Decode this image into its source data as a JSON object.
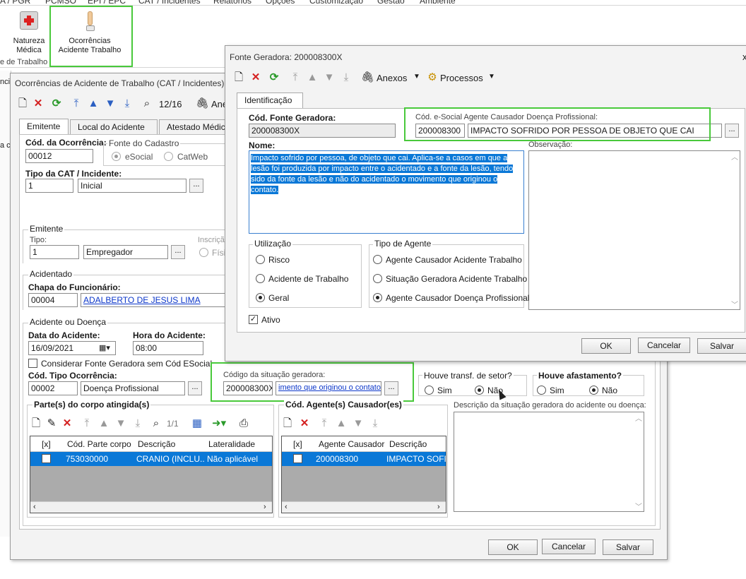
{
  "ribbon": {
    "tabs": [
      "A / PGR",
      "PCMSO",
      "EPI / EPC",
      "CAT / Incidentes",
      "Relatórios",
      "Opções",
      "Customização",
      "Gestão",
      "Ambiente"
    ],
    "btn_natureza": "Natureza\nMédica",
    "btn_ocorrencias": "Ocorrências\nAcidente Trabalho",
    "group_label": "e de Trabalho"
  },
  "left_edge": {
    "t1": "nci",
    "t2": "a c"
  },
  "cat": {
    "title": "Ocorrências de Acidente de Trabalho (CAT / Incidentes): 000",
    "record": "12/16",
    "anexos_partial": "Ane",
    "tabs": [
      "Emitente",
      "Local do Acidente",
      "Atestado Médico"
    ],
    "cod_ocorrencia_label": "Cód. da Ocorrência:",
    "cod_ocorrencia": "00012",
    "fonte_cadastro_label": "Fonte do Cadastro",
    "fonte_esocial": "eSocial",
    "fonte_catweb": "CatWeb",
    "tipo_cat_label": "Tipo da CAT / Incidente:",
    "tipo_cat_code": "1",
    "tipo_cat_desc": "Inicial",
    "emitente_group": "Emitente",
    "tipo_label": "Tipo:",
    "tipo_code": "1",
    "tipo_desc": "Empregador",
    "inscricao_label": "Inscriçã",
    "fisica_label": "Físic",
    "acidentado_group": "Acidentado",
    "chapa_label": "Chapa do Funcionário:",
    "chapa_code": "00004",
    "chapa_name": "ADALBERTO DE JESUS LIMA",
    "acidente_group": "Acidente ou Doença",
    "data_label": "Data do Acidente:",
    "data_value": "16/09/2021",
    "hora_label": "Hora do Acidente:",
    "hora_value": "08:00",
    "considerar_label": "Considerar Fonte Geradora sem Cód ESocial",
    "tipo_oc_label": "Cód. Tipo Ocorrência:",
    "tipo_oc_code": "00002",
    "tipo_oc_desc": "Doença Profissional",
    "cod_sit_label": "Código da situação geradora:",
    "cod_sit_value": "200008300X",
    "cod_sit_desc": "imento que originou o contato.",
    "transf_label": "Houve transf. de setor?",
    "transf_sim": "Sim",
    "transf_nao": "Não",
    "afast_label": "Houve afastamento?",
    "afast_sim": "Sim",
    "afast_nao": "Não",
    "partes_label": "Parte(s) do corpo atingida(s)",
    "partes_record": "1/1",
    "partes_cols": [
      "[x]",
      "Cód. Parte corpo",
      "Descrição",
      "Lateralidade"
    ],
    "partes_row": [
      "753030000",
      "CRANIO (INCLU...",
      "Não aplicável"
    ],
    "agentes_label": "Cód. Agente(s) Causador(es)",
    "agentes_cols": [
      "[x]",
      "Agente Causador",
      "Descrição"
    ],
    "agentes_row": [
      "200008300",
      "IMPACTO SOFRI"
    ],
    "desc_sit_label": "Descrição da situação geradora do acidente ou doença:",
    "ok": "OK",
    "cancelar": "Cancelar",
    "salvar": "Salvar"
  },
  "fonte": {
    "title": "Fonte Geradora: 200008300X",
    "close": "x",
    "anexos": "Anexos",
    "processos": "Processos",
    "tab": "Identificação",
    "cod_label": "Cód. Fonte Geradora:",
    "cod_value": "200008300X",
    "esocial_label": "Cód. e-Social Agente Causador Doença Profissional:",
    "esocial_code": "200008300",
    "esocial_desc": "IMPACTO SOFRIDO POR PESSOA DE OBJETO QUE CAI",
    "nome_label": "Nome:",
    "nome_text": "Impacto sofrido por pessoa, de objeto que cai. Aplica-se a casos em que a lesão foi produzida por impacto entre o acidentado e a fonte da lesão, tendo sido da fonte da lesão e não do acidentado o movimento que originou o contato.",
    "obs_label": "Observação:",
    "util_group": "Utilização",
    "util_risco": "Risco",
    "util_acidente": "Acidente de Trabalho",
    "util_geral": "Geral",
    "agente_group": "Tipo de Agente",
    "agente_1": "Agente Causador Acidente Trabalho",
    "agente_2": "Situação Geradora Acidente Trabalho",
    "agente_3": "Agente Causador Doença Profissional",
    "ativo": "Ativo",
    "ok": "OK",
    "cancelar": "Cancelar",
    "salvar": "Salvar"
  },
  "colors": {
    "highlight": "#49c93b",
    "selection": "#0a78d7",
    "link": "#0b36c9"
  }
}
